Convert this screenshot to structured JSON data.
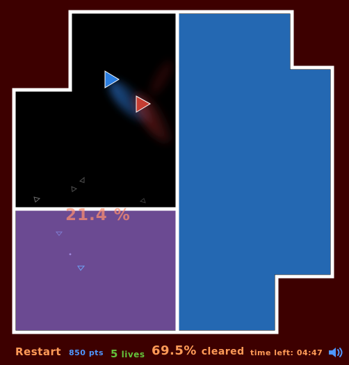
{
  "hud": {
    "restart_label": "Restart",
    "points": "850",
    "points_unit": "pts",
    "lives": "5",
    "lives_unit": "lives",
    "cleared_percent": "69.5%",
    "cleared_label": "cleared",
    "time_label": "time left:",
    "time_value": "04:47"
  },
  "board": {
    "region_percent_label": "21.4 %",
    "colors": {
      "background": "#3d0000",
      "active_area": "#000000",
      "cleared_blue": "#2468b2",
      "cleared_purple": "#6b4a92",
      "wall": "#ffffff"
    },
    "ships": {
      "player_color": "#2b7ee0",
      "enemy_color": "#c43d32"
    }
  },
  "icons": {
    "sound": "speaker-icon"
  }
}
